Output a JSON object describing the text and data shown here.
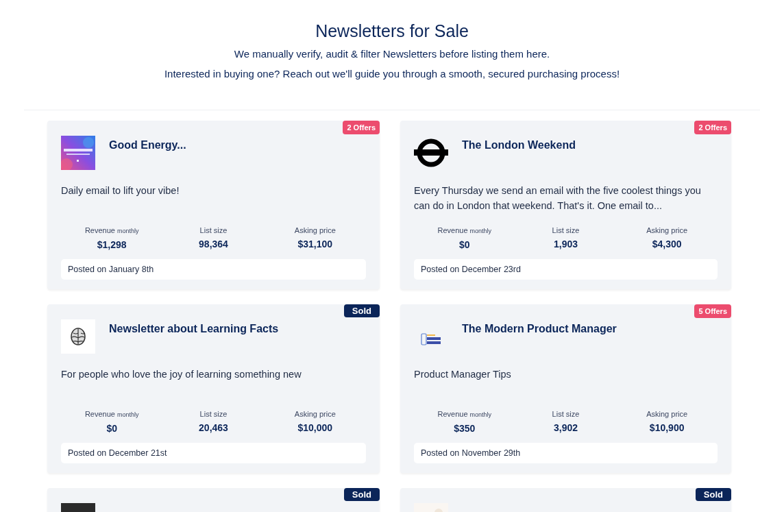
{
  "header": {
    "title": "Newsletters for Sale",
    "lines": [
      "We manually verify, audit & filter Newsletters before listing them here.",
      "Interested in buying one? Reach out we'll guide you through a smooth, secured purchasing process!"
    ]
  },
  "listings": [
    {
      "title": "Good Energy...",
      "badge": {
        "kind": "offers",
        "label": "2 Offers"
      },
      "description": "Daily email to lift your vibe!",
      "stats": [
        {
          "label": "Revenue",
          "sub": "monthly",
          "value": "$1,298"
        },
        {
          "label": "List size",
          "value": "98,364"
        },
        {
          "label": "Asking price",
          "value": "$31,100"
        }
      ],
      "posted": "Posted on January 8th"
    },
    {
      "logo": {
        "kind": "roundel"
      },
      "title": "The London Weekend",
      "badge": {
        "kind": "offers",
        "label": "2 Offers"
      },
      "description": "Every Thursday we send an email with the five coolest things you can do in London that weekend. That's it. One email to...",
      "stats": [
        {
          "label": "Revenue",
          "sub": "monthly",
          "value": "$0"
        },
        {
          "label": "List size",
          "value": "1,903"
        },
        {
          "label": "Asking price",
          "value": "$4,300"
        }
      ],
      "posted": "Posted on December 23rd"
    },
    {
      "logo": {
        "kind": "brain"
      },
      "title": "Newsletter about Learning Facts",
      "badge": {
        "kind": "sold",
        "label": "Sold"
      },
      "description": "For people who love the joy of learning something new",
      "stats": [
        {
          "label": "Revenue",
          "sub": "monthly",
          "value": "$0"
        },
        {
          "label": "List size",
          "value": "20,463"
        },
        {
          "label": "Asking price",
          "value": "$10,000"
        }
      ],
      "posted": "Posted on December 21st"
    },
    {
      "logo": {
        "kind": "product"
      },
      "title": "The Modern Product Manager",
      "badge": {
        "kind": "offers",
        "label": "5 Offers"
      },
      "description": "Product Manager Tips",
      "stats": [
        {
          "label": "Revenue",
          "sub": "monthly",
          "value": "$350"
        },
        {
          "label": "List size",
          "value": "3,902"
        },
        {
          "label": "Asking price",
          "value": "$10,900"
        }
      ],
      "posted": "Posted on November 29th"
    },
    {
      "logo": {
        "kind": "dark"
      },
      "badge": {
        "kind": "sold",
        "label": "Sold"
      }
    },
    {
      "logo": {
        "kind": "light"
      },
      "badge": {
        "kind": "sold",
        "label": "Sold"
      }
    }
  ]
}
